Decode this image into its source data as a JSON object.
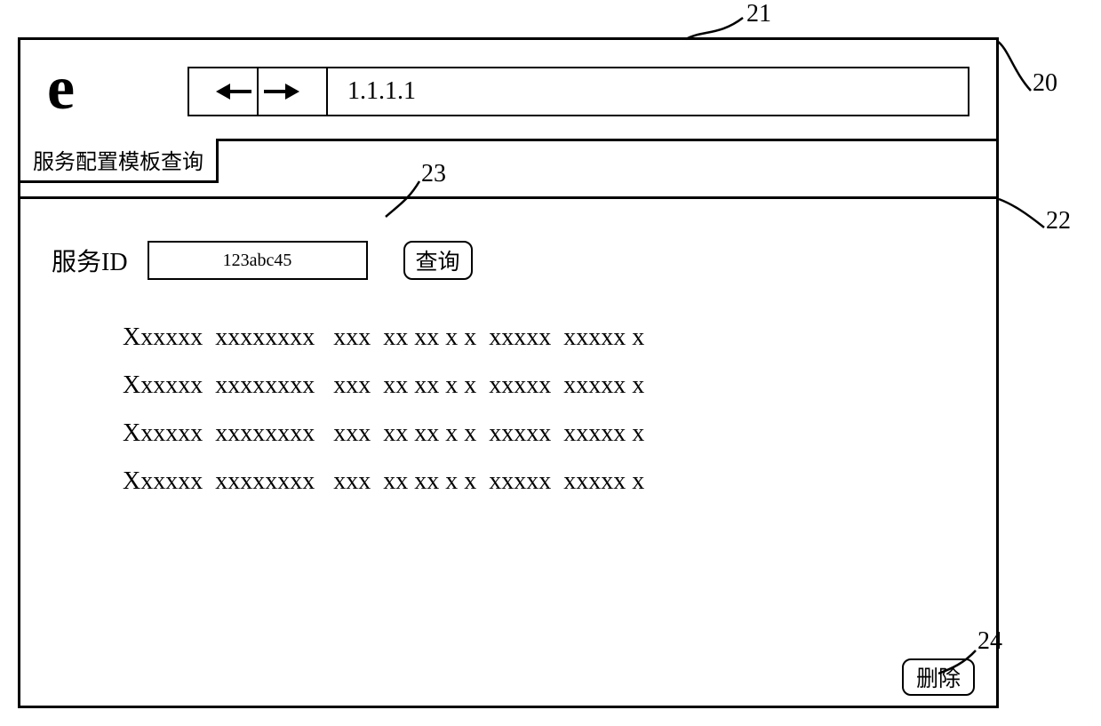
{
  "browser": {
    "logo": "e",
    "address": "1.1.1.1"
  },
  "tab": {
    "label": "服务配置模板查询"
  },
  "content": {
    "service_id_label": "服务ID",
    "service_id_value": "123abc45",
    "query_button": "查询",
    "delete_button": "删除",
    "result_line": "Xxxxxx  xxxxxxxx   xxx  xx xx x x  xxxxx  xxxxx x"
  },
  "callouts": {
    "c20": "20",
    "c21": "21",
    "c22": "22",
    "c23": "23",
    "c24": "24"
  }
}
